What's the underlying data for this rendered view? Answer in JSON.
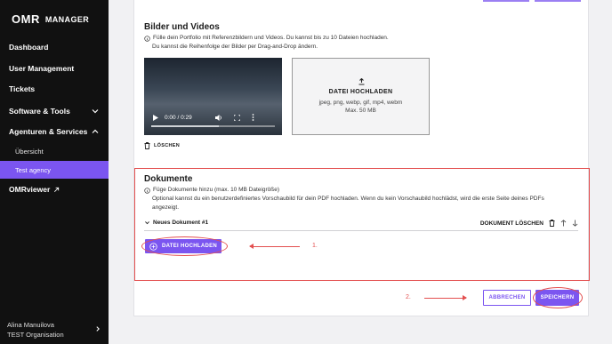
{
  "brand": {
    "logo": "OMR",
    "product": "MANAGER"
  },
  "sidebar": {
    "items": [
      {
        "label": "Dashboard"
      },
      {
        "label": "User Management"
      },
      {
        "label": "Tickets"
      },
      {
        "label": "Software & Tools"
      },
      {
        "label": "Agenturen & Services"
      },
      {
        "label": "Übersicht"
      },
      {
        "label": "Test agency"
      },
      {
        "label": "OMRviewer"
      }
    ],
    "user_name": "Alina Manuilova",
    "org": "TEST Organisation"
  },
  "media": {
    "title": "Bilder und Videos",
    "hint1": "Fülle dein Portfolio mit Referenzbildern und Videos. Du kannst bis zu 10 Dateien hochladen.",
    "hint2": "Du kannst die Reihenfolge der Bilder per Drag-and-Drop ändern.",
    "video_time": "0:00 / 0:29",
    "upload_title": "DATEI HOCHLADEN",
    "upload_types": "jpeg, png, webp, gif, mp4, webm",
    "upload_max": "Max. 50 MB",
    "delete": "LÖSCHEN"
  },
  "documents": {
    "title": "Dokumente",
    "hint1": "Füge Dokumente hinzu (max. 10 MB Dateigröße)",
    "hint2": "Optional kannst du ein benutzerdefiniertes Vorschaubild für dein PDF hochladen. Wenn du kein Vorschaubild hochlädst, wird die erste Seite deines PDFs angezeigt.",
    "row_title": "Neues Dokument #1",
    "delete_doc": "DOKUMENT LÖSCHEN",
    "upload_btn": "DATEI HOCHLADEN"
  },
  "actions": {
    "cancel": "ABBRECHEN",
    "save": "SPEICHERN"
  },
  "annotations": {
    "step1": "1.",
    "step2": "2."
  },
  "colors": {
    "accent": "#7b55f0",
    "annotation": "#e34f4f",
    "sidebar": "#111111"
  }
}
